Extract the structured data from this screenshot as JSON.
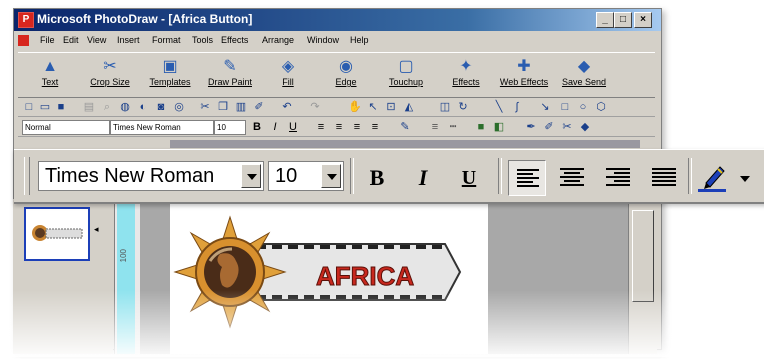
{
  "window": {
    "title": "Microsoft PhotoDraw - [Africa Button]",
    "app_icon_glyph": "P",
    "controls": [
      "_",
      "□",
      "×"
    ]
  },
  "menu": [
    "File",
    "Edit",
    "View",
    "Insert",
    "Format",
    "Tools",
    "Effects",
    "Arrange",
    "Window",
    "Help"
  ],
  "big_toolbar": [
    {
      "label": "Text",
      "icon": "text-icon"
    },
    {
      "label": "Crop Size",
      "icon": "crop-icon"
    },
    {
      "label": "Templates",
      "icon": "templates-icon"
    },
    {
      "label": "Draw Paint",
      "icon": "draw-paint-icon"
    },
    {
      "label": "Fill",
      "icon": "fill-icon"
    },
    {
      "label": "Edge",
      "icon": "edge-icon"
    },
    {
      "label": "Touchup",
      "icon": "touchup-icon"
    },
    {
      "label": "Effects",
      "icon": "effects-icon"
    },
    {
      "label": "Web Effects",
      "icon": "web-effects-icon"
    },
    {
      "label": "Save Send",
      "icon": "save-send-icon"
    }
  ],
  "format_bar_small": {
    "style": "Normal",
    "font": "Times New Roman",
    "size": "10"
  },
  "zoomed_bar": {
    "font": "Times New Roman",
    "size": "10",
    "bold": "B",
    "italic": "I",
    "underline": "U"
  },
  "thumbnail": {
    "arrow": "◂"
  },
  "ruler_label": "100",
  "image": {
    "banner_text": "AFRICA"
  },
  "colors": {
    "titlebar": "#0a246a",
    "banner_text": "#c8281e",
    "ruler_blue": "#8fe3ee",
    "accent_blue": "#1c3fb8"
  }
}
